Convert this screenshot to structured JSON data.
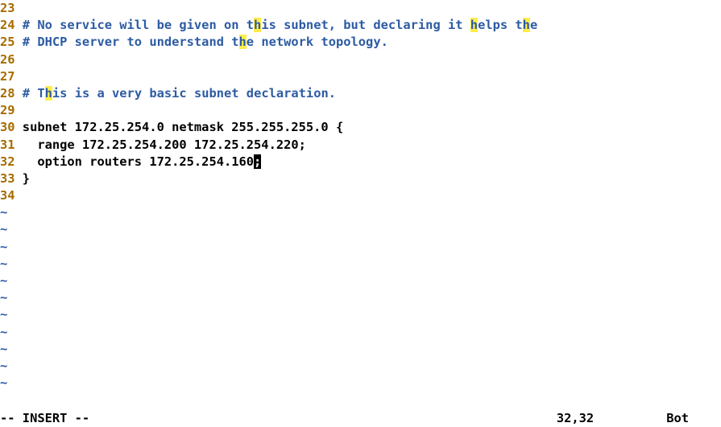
{
  "lines": [
    {
      "n": "23",
      "segments": []
    },
    {
      "n": "24",
      "segments": [
        {
          "t": "# No service will be given on t",
          "c": "comment"
        },
        {
          "t": "h",
          "c": "comment hl"
        },
        {
          "t": "is subnet, but declaring it ",
          "c": "comment"
        },
        {
          "t": "h",
          "c": "comment hl"
        },
        {
          "t": "elps t",
          "c": "comment"
        },
        {
          "t": "h",
          "c": "comment hl"
        },
        {
          "t": "e",
          "c": "comment"
        }
      ]
    },
    {
      "n": "25",
      "segments": [
        {
          "t": "# DHCP server to understand t",
          "c": "comment"
        },
        {
          "t": "h",
          "c": "comment hl"
        },
        {
          "t": "e network topology.",
          "c": "comment"
        }
      ]
    },
    {
      "n": "26",
      "segments": []
    },
    {
      "n": "27",
      "segments": []
    },
    {
      "n": "28",
      "segments": [
        {
          "t": "# T",
          "c": "comment"
        },
        {
          "t": "h",
          "c": "comment hl"
        },
        {
          "t": "is is a very basic subnet declaration.",
          "c": "comment"
        }
      ]
    },
    {
      "n": "29",
      "segments": []
    },
    {
      "n": "30",
      "segments": [
        {
          "t": "subnet 172.25.254.0 netmask 255.255.255.0 {",
          "c": "plain"
        }
      ]
    },
    {
      "n": "31",
      "segments": [
        {
          "t": "  range 172.25.254.200 172.25.254.220;",
          "c": "plain"
        }
      ]
    },
    {
      "n": "32",
      "segments": [
        {
          "t": "  option routers 172.25.254.160",
          "c": "plain"
        },
        {
          "t": ";",
          "c": "cursor-block"
        }
      ]
    },
    {
      "n": "33",
      "segments": [
        {
          "t": "}",
          "c": "plain"
        }
      ]
    },
    {
      "n": "34",
      "segments": []
    }
  ],
  "tilde_count": 11,
  "status": {
    "mode": "-- INSERT --",
    "position": "32,32",
    "location": "Bot"
  }
}
